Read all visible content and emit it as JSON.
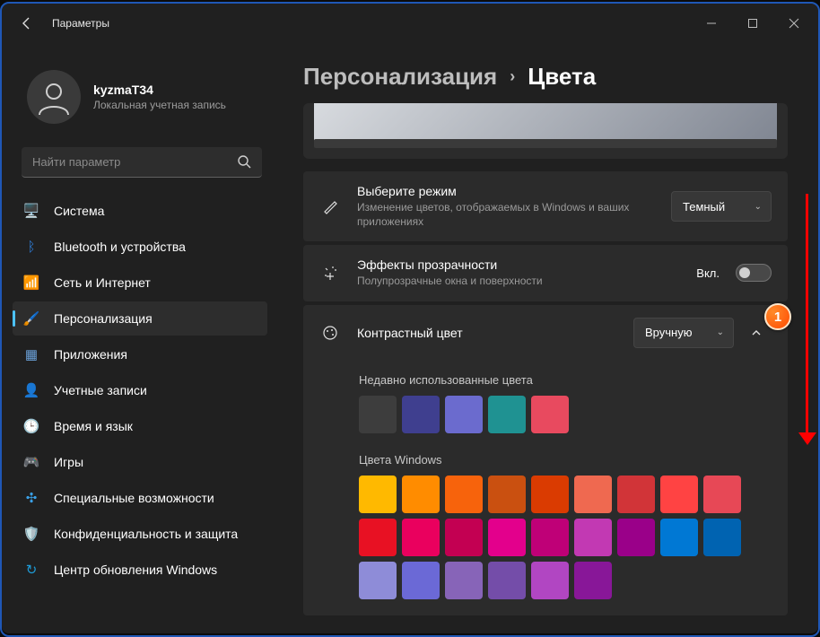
{
  "window": {
    "title": "Параметры"
  },
  "user": {
    "name": "kyzmaT34",
    "subtitle": "Локальная учетная запись"
  },
  "search": {
    "placeholder": "Найти параметр"
  },
  "sidebar": {
    "items": [
      {
        "label": "Система",
        "icon": "🖥️",
        "color": "#4cc2ff"
      },
      {
        "label": "Bluetooth и устройства",
        "icon": "ᛒ",
        "color": "#2e7cd6"
      },
      {
        "label": "Сеть и Интернет",
        "icon": "📶",
        "color": "#18c2c2"
      },
      {
        "label": "Персонализация",
        "icon": "🖌️",
        "color": "#6b4a2a"
      },
      {
        "label": "Приложения",
        "icon": "▦",
        "color": "#6aa0d8"
      },
      {
        "label": "Учетные записи",
        "icon": "👤",
        "color": "#6aa0d8"
      },
      {
        "label": "Время и язык",
        "icon": "🕒",
        "color": "#6aa0d8"
      },
      {
        "label": "Игры",
        "icon": "🎮",
        "color": "#8f8f8f"
      },
      {
        "label": "Специальные возможности",
        "icon": "✣",
        "color": "#3aa0e6"
      },
      {
        "label": "Конфиденциальность и защита",
        "icon": "🛡️",
        "color": "#9aa4ae"
      },
      {
        "label": "Центр обновления Windows",
        "icon": "↻",
        "color": "#1e9cd8"
      }
    ],
    "active_index": 3
  },
  "breadcrumb": {
    "parent": "Персонализация",
    "current": "Цвета"
  },
  "mode": {
    "title": "Выберите режим",
    "subtitle": "Изменение цветов, отображаемых в Windows и ваших приложениях",
    "value": "Темный"
  },
  "transparency": {
    "title": "Эффекты прозрачности",
    "subtitle": "Полупрозрачные окна и поверхности",
    "state_label": "Вкл.",
    "enabled": false
  },
  "accent": {
    "title": "Контрастный цвет",
    "value": "Вручную",
    "recent_label": "Недавно использованные цвета",
    "recent": [
      "#3d3d3d",
      "#3f3f8f",
      "#6b6bce",
      "#1f9292",
      "#e84a5f"
    ],
    "windows_label": "Цвета Windows",
    "palette": [
      "#ffb900",
      "#ff8c00",
      "#f7630c",
      "#ca5010",
      "#da3b01",
      "#ef6950",
      "#d13438",
      "#ff4343",
      "#e74856",
      "#e81123",
      "#ea005e",
      "#c30052",
      "#e3008c",
      "#bf0077",
      "#c239b3",
      "#9a0089",
      "#0078d4",
      "#0063b1",
      "#8e8cd8",
      "#6b69d6",
      "#8764b8",
      "#744da9",
      "#b146c2",
      "#881798"
    ]
  },
  "annotation": {
    "badge": "1"
  }
}
